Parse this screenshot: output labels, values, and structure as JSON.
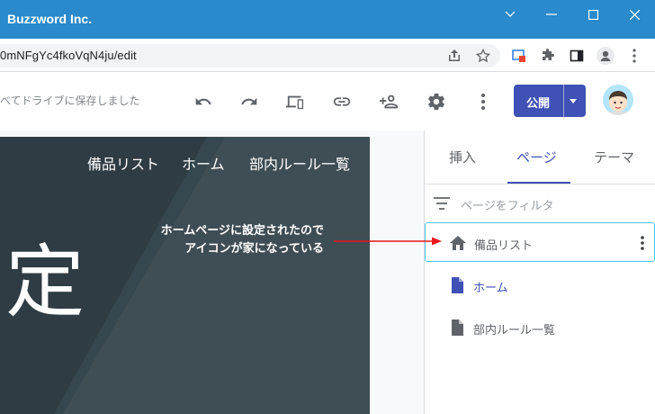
{
  "window": {
    "title": "Buzzword Inc."
  },
  "address_bar": {
    "url": "0mNFgYc4fkoVqN4ju/edit"
  },
  "toolbar": {
    "saved_status": "べてドライブに保存しました",
    "publish_label": "公開"
  },
  "site": {
    "nav": [
      "備品リスト",
      "ホーム",
      "部内ルール一覧"
    ],
    "big_text": "定"
  },
  "annotation": {
    "line1": "ホームページに設定されたので",
    "line2": "アイコンが家になっている",
    "arrow_color": "#e8151b"
  },
  "panel": {
    "tabs": [
      "挿入",
      "ページ",
      "テーマ"
    ],
    "active_tab": "ページ",
    "filter_placeholder": "ページをフィルタ",
    "pages": [
      {
        "label": "備品リスト",
        "icon": "home-icon",
        "selected": true
      },
      {
        "label": "ホーム",
        "icon": "page-icon",
        "selected": false
      },
      {
        "label": "部内ルール一覧",
        "icon": "page-icon",
        "selected": false
      }
    ]
  },
  "colors": {
    "titlebar": "#2a8acb",
    "accent": "#3f51b5",
    "hero": "#37474f",
    "selection_border": "#4fc3f7"
  }
}
